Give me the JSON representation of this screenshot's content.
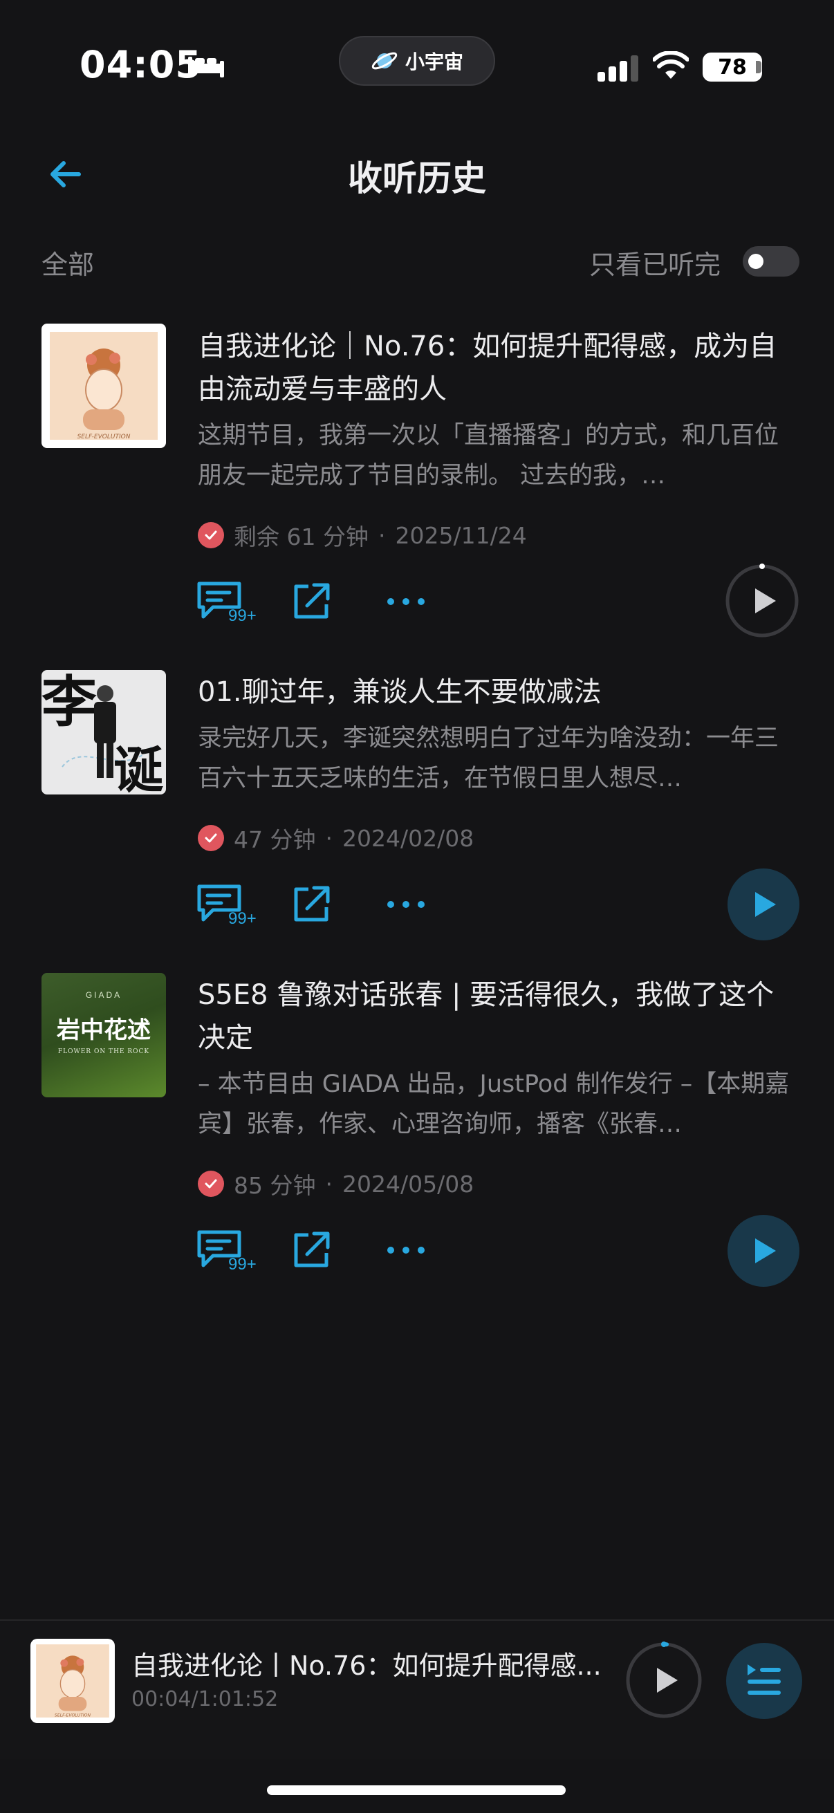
{
  "status_bar": {
    "time": "04:05",
    "island_label": "小宇宙",
    "battery": "78"
  },
  "header": {
    "title": "收听历史"
  },
  "filters": {
    "all_label": "全部",
    "finished_only_label": "只看已听完",
    "finished_only_on": false
  },
  "colors": {
    "accent": "#29a8e0",
    "check": "#e0565e",
    "background": "#141416"
  },
  "episodes": [
    {
      "title": "自我进化论｜No.76：如何提升配得感，成为自由流动爱与丰盛的人",
      "description": "这期节目，我第一次以「直播播客」的方式，和几百位朋友一起完成了节目的录制。 过去的我，…",
      "duration": "剩余 61 分钟",
      "date": "2025/11/24",
      "comment_badge": "99+",
      "cover_text": "SELF-EVOLUTION"
    },
    {
      "title": "01.聊过年，兼谈人生不要做减法",
      "description": "录完好几天，李诞突然想明白了过年为啥没劲：一年三百六十五天乏味的生活，在节假日里人想尽…",
      "duration": "47 分钟",
      "date": "2024/02/08",
      "comment_badge": "99+",
      "cover_text_1": "李",
      "cover_text_2": "诞"
    },
    {
      "title": "S5E8 鲁豫对话张春 | 要活得很久，我做了这个决定",
      "description": "– 本节目由 GIADA 出品，JustPod 制作发行 –【本期嘉宾】张春，作家、心理咨询师，播客《张春…",
      "duration": "85 分钟",
      "date": "2024/05/08",
      "comment_badge": "99+",
      "cover_brand": "GIADA",
      "cover_title": "岩中花述",
      "cover_subtitle": "FLOWER ON THE ROCK"
    }
  ],
  "mini_player": {
    "title": "自我进化论丨No.76：如何提升配得感...",
    "time": "00:04/1:01:52",
    "cover_text": "SELF-EVOLUTION"
  }
}
